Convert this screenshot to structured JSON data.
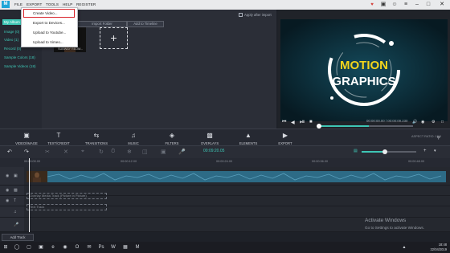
{
  "menu": {
    "file": "FILE",
    "export": "EXPORT",
    "tools": "TOOLS",
    "help": "HELP",
    "register": "REGISTER"
  },
  "export_menu": [
    "Create Video...",
    "Export to Devices...",
    "Upload to Youtube...",
    "Upload to Vimeo..."
  ],
  "sidebar": {
    "items": [
      "My Album",
      "Image (0)",
      "Video (1)",
      "Record (0)",
      "Sample Colors (18)",
      "Sample Videos (18)"
    ]
  },
  "media": {
    "import_folder": "Import Folder",
    "add_to_timeline": "Add to Timeline",
    "apply_after_import": "Apply after import",
    "thumb_caption": "SUBWAY REDM..."
  },
  "preview": {
    "line1": "MOTION",
    "line2": "GRAPHICS",
    "time": "00:00:00.00 / 00:00:09.230"
  },
  "categories": [
    "VIDEO/IMAGE",
    "TEXT/CREDIT",
    "TRANSITIONS",
    "MUSIC",
    "FILTERS",
    "OVERLAYS",
    "ELEMENTS",
    "EXPORT"
  ],
  "aspect_ratio": "ASPECT RATIO: 16:9",
  "timeline": {
    "current_time": "00:09:20.05",
    "ruler": [
      "00:00:00.00",
      "00:00:12.00",
      "00:00:24.00",
      "00:00:36.00",
      "00:00:48.00"
    ],
    "overlay_placeholder": "Overlay Media Track (Picture in Picture)",
    "text_placeholder": "Text Track",
    "add_track": "Add Track"
  },
  "watermark": {
    "title": "Activate Windows",
    "subtitle": "Go to Settings to activate Windows."
  },
  "taskbar": {
    "time": "18:48",
    "date": "22/04/2019"
  },
  "colors": {
    "accent": "#3ec6b5",
    "highlight": "#d8232a",
    "logo": "#1fa6d8"
  }
}
